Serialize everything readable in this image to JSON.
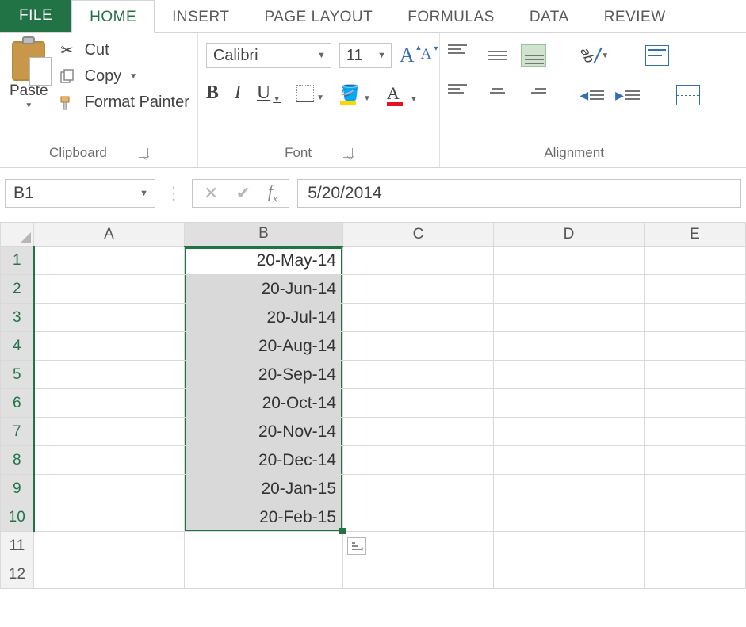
{
  "tabs": {
    "file": "FILE",
    "home": "HOME",
    "insert": "INSERT",
    "page_layout": "PAGE LAYOUT",
    "formulas": "FORMULAS",
    "data": "DATA",
    "review": "REVIEW",
    "active": "home"
  },
  "ribbon": {
    "clipboard": {
      "title": "Clipboard",
      "paste": "Paste",
      "cut": "Cut",
      "copy": "Copy",
      "format_painter": "Format Painter"
    },
    "font": {
      "title": "Font",
      "name": "Calibri",
      "size": "11"
    },
    "alignment": {
      "title": "Alignment"
    }
  },
  "bar": {
    "namebox": "B1",
    "formula": "5/20/2014"
  },
  "grid": {
    "cols": [
      "A",
      "B",
      "C",
      "D",
      "E"
    ],
    "rows": [
      1,
      2,
      3,
      4,
      5,
      6,
      7,
      8,
      9,
      10,
      11,
      12
    ],
    "selected_col": "B",
    "selected_rows": [
      1,
      2,
      3,
      4,
      5,
      6,
      7,
      8,
      9,
      10
    ],
    "active_cell": "B1",
    "data": {
      "B1": "20-May-14",
      "B2": "20-Jun-14",
      "B3": "20-Jul-14",
      "B4": "20-Aug-14",
      "B5": "20-Sep-14",
      "B6": "20-Oct-14",
      "B7": "20-Nov-14",
      "B8": "20-Dec-14",
      "B9": "20-Jan-15",
      "B10": "20-Feb-15"
    }
  }
}
